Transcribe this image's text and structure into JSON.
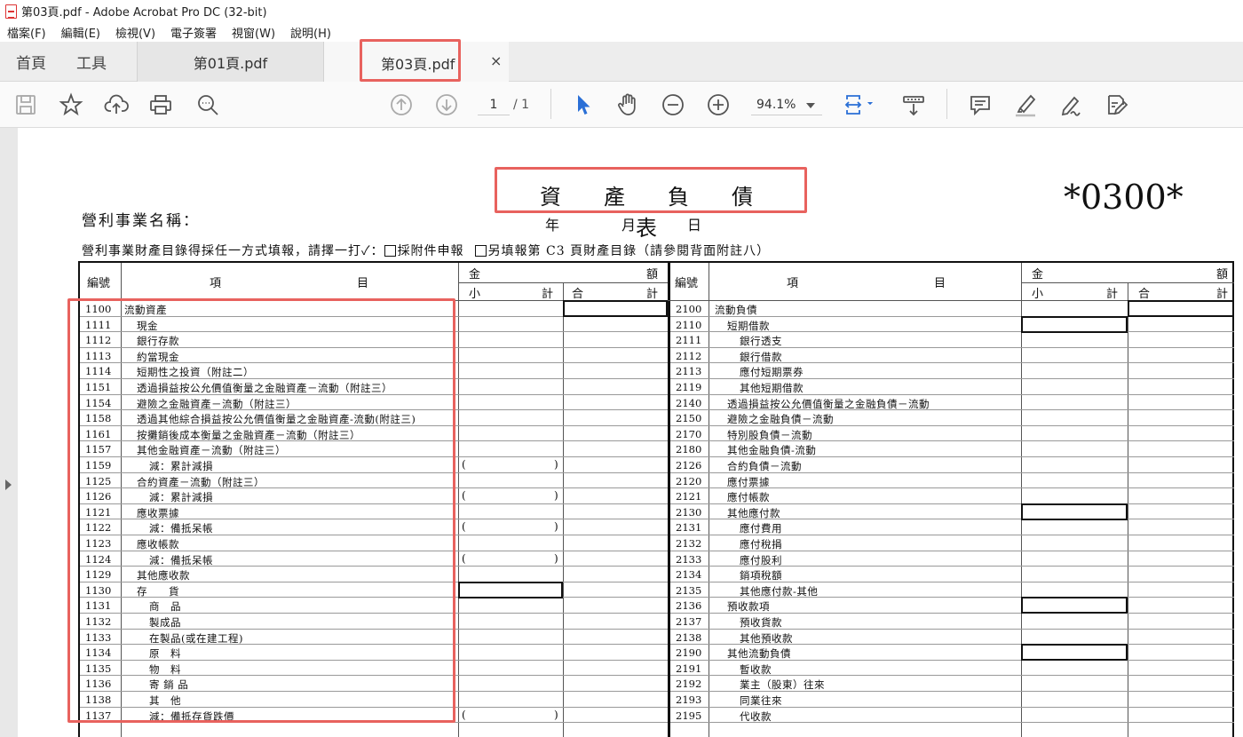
{
  "window": {
    "title": "第03頁.pdf - Adobe Acrobat Pro DC (32-bit)"
  },
  "menu": [
    "檔案(F)",
    "編輯(E)",
    "檢視(V)",
    "電子簽署",
    "視窗(W)",
    "說明(H)"
  ],
  "tabs": {
    "home": "首頁",
    "tools": "工具",
    "doc1": "第01頁.pdf",
    "doc2": "第03頁.pdf",
    "close": "×"
  },
  "toolbar": {
    "page_current": "1",
    "page_total": "/ 1",
    "zoom": "94.1%"
  },
  "colors": {
    "highlight": "#e8625e",
    "select_tool": "#2a6fd6"
  },
  "document": {
    "title": "資產負債表",
    "form_code": "*0300*",
    "business_name_label": "營利事業名稱：",
    "year": "年",
    "month": "月",
    "day": "日",
    "note_prefix": "營利事業財產目錄得採任一方式填報，請擇一打✓：",
    "option1": "採附件申報",
    "option2": "另填報第 C3 頁財產目錄（請參閱背面附註八）",
    "headers": {
      "code": "編號",
      "item_left": "項",
      "item_right": "目",
      "amount_left": "金",
      "amount_right": "額",
      "subtotal_left": "小",
      "subtotal_right": "計",
      "total_left": "合",
      "total_right": "計"
    },
    "left_rows": [
      {
        "code": "1100",
        "name": "流動資產"
      },
      {
        "code": "1111",
        "name": "現金"
      },
      {
        "code": "1112",
        "name": "銀行存款"
      },
      {
        "code": "1113",
        "name": "約當現金"
      },
      {
        "code": "1114",
        "name": "短期性之投資（附註二）"
      },
      {
        "code": "1151",
        "name": "透過損益按公允價值衡量之金融資產－流動（附註三）"
      },
      {
        "code": "1154",
        "name": "避險之金融資產－流動（附註三）"
      },
      {
        "code": "1158",
        "name": "透過其他綜合損益按公允價值衡量之金融資產-流動(附註三)"
      },
      {
        "code": "1161",
        "name": "按攤銷後成本衡量之金融資產－流動（附註三）"
      },
      {
        "code": "1157",
        "name": "其他金融資產－流動（附註三）"
      },
      {
        "code": "1159",
        "name": "減：累計減損"
      },
      {
        "code": "1125",
        "name": "合約資產－流動（附註三）"
      },
      {
        "code": "1126",
        "name": "減：累計減損"
      },
      {
        "code": "1121",
        "name": "應收票據"
      },
      {
        "code": "1122",
        "name": "減：備抵呆帳"
      },
      {
        "code": "1123",
        "name": "應收帳款"
      },
      {
        "code": "1124",
        "name": "減：備抵呆帳"
      },
      {
        "code": "1129",
        "name": "其他應收款"
      },
      {
        "code": "1130",
        "name": "存　　貨"
      },
      {
        "code": "1131",
        "name": "商　品"
      },
      {
        "code": "1132",
        "name": "製成品"
      },
      {
        "code": "1133",
        "name": "在製品(或在建工程)"
      },
      {
        "code": "1134",
        "name": "原　料"
      },
      {
        "code": "1135",
        "name": "物　料"
      },
      {
        "code": "1136",
        "name": "寄 銷 品"
      },
      {
        "code": "1138",
        "name": "其　他"
      },
      {
        "code": "1137",
        "name": "減：備抵存貨跌價"
      }
    ],
    "right_rows": [
      {
        "code": "2100",
        "name": "流動負債"
      },
      {
        "code": "2110",
        "name": "短期借款"
      },
      {
        "code": "2111",
        "name": "銀行透支"
      },
      {
        "code": "2112",
        "name": "銀行借款"
      },
      {
        "code": "2113",
        "name": "應付短期票券"
      },
      {
        "code": "2119",
        "name": "其他短期借款"
      },
      {
        "code": "2140",
        "name": "透過損益按公允價值衡量之金融負債－流動"
      },
      {
        "code": "2150",
        "name": "避險之金融負債－流動"
      },
      {
        "code": "2170",
        "name": "特別股負債－流動"
      },
      {
        "code": "2180",
        "name": "其他金融負債-流動"
      },
      {
        "code": "2126",
        "name": "合約負債－流動"
      },
      {
        "code": "2120",
        "name": "應付票據"
      },
      {
        "code": "2121",
        "name": "應付帳款"
      },
      {
        "code": "2130",
        "name": "其他應付款"
      },
      {
        "code": "2131",
        "name": "應付費用"
      },
      {
        "code": "2132",
        "name": "應付稅捐"
      },
      {
        "code": "2133",
        "name": "應付股利"
      },
      {
        "code": "2134",
        "name": "銷項稅額"
      },
      {
        "code": "2135",
        "name": "其他應付款-其他"
      },
      {
        "code": "2136",
        "name": "預收款項"
      },
      {
        "code": "2137",
        "name": "預收貨款"
      },
      {
        "code": "2138",
        "name": "其他預收款"
      },
      {
        "code": "2190",
        "name": "其他流動負債"
      },
      {
        "code": "2191",
        "name": "暫收款"
      },
      {
        "code": "2192",
        "name": "業主（股東）往來"
      },
      {
        "code": "2193",
        "name": "同業往來"
      },
      {
        "code": "2195",
        "name": "代收款"
      }
    ]
  }
}
